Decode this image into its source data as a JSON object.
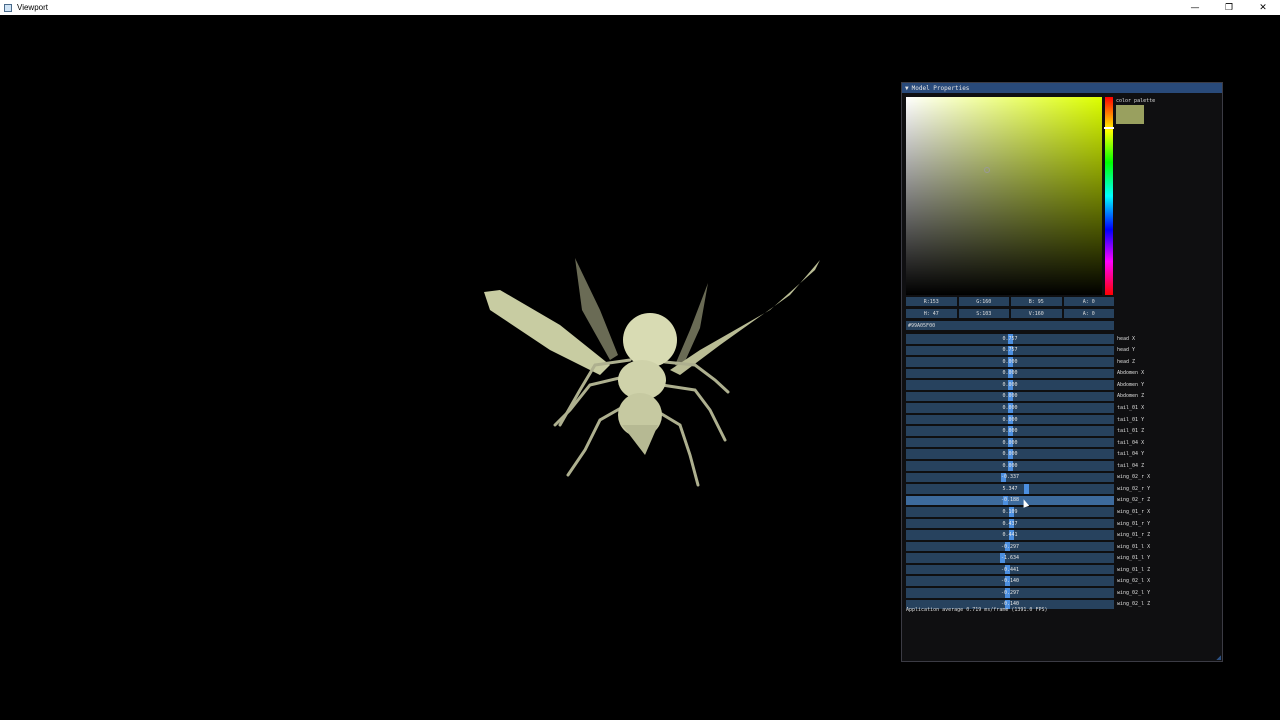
{
  "window": {
    "title": "Viewport",
    "controls": {
      "minimize": "—",
      "maximize": "❐",
      "close": "✕"
    }
  },
  "panel": {
    "title": "Model Properties",
    "collapse_icon": "triangle-down-icon",
    "color_picker": {
      "palette_label": "color palette",
      "swatch_color": "#99A05F",
      "rgba": {
        "r": "R:153",
        "g": "G:160",
        "b": "B: 95",
        "a": "A:  0"
      },
      "hsva": {
        "h": "H: 47",
        "s": "S:103",
        "v": "V:160",
        "a": "A:  0"
      },
      "hex": "#99A05F00"
    },
    "sliders": [
      {
        "value": "0.757",
        "label": "head X",
        "fraction": 0.5
      },
      {
        "value": "0.757",
        "label": "head Y",
        "fraction": 0.5
      },
      {
        "value": "0.000",
        "label": "head Z",
        "fraction": 0.5
      },
      {
        "value": "0.000",
        "label": "Abdomen X",
        "fraction": 0.5
      },
      {
        "value": "0.000",
        "label": "Abdomen Y",
        "fraction": 0.5
      },
      {
        "value": "0.000",
        "label": "Abdomen Z",
        "fraction": 0.5
      },
      {
        "value": "0.000",
        "label": "tail_01 X",
        "fraction": 0.5
      },
      {
        "value": "0.000",
        "label": "tail_01 Y",
        "fraction": 0.5
      },
      {
        "value": "0.000",
        "label": "tail_01 Z",
        "fraction": 0.5
      },
      {
        "value": "0.000",
        "label": "tail_04 X",
        "fraction": 0.5
      },
      {
        "value": "0.000",
        "label": "tail_04 Y",
        "fraction": 0.5
      },
      {
        "value": "0.000",
        "label": "tail_04 Z",
        "fraction": 0.5
      },
      {
        "value": "-0.337",
        "label": "wing_02_r X",
        "fraction": 0.47
      },
      {
        "value": "5.347",
        "label": "wing_02_r Y",
        "fraction": 0.58
      },
      {
        "value": "-0.188",
        "label": "wing_02_r Z",
        "fraction": 0.48,
        "active": true
      },
      {
        "value": "0.109",
        "label": "wing_01_r X",
        "fraction": 0.505
      },
      {
        "value": "0.437",
        "label": "wing_01_r Y",
        "fraction": 0.505
      },
      {
        "value": "0.441",
        "label": "wing_01_r Z",
        "fraction": 0.505
      },
      {
        "value": "-0.297",
        "label": "wing_01_l X",
        "fraction": 0.49
      },
      {
        "value": "-1.634",
        "label": "wing_01_l Y",
        "fraction": 0.465
      },
      {
        "value": "-0.441",
        "label": "wing_01_l Z",
        "fraction": 0.49
      },
      {
        "value": "-0.140",
        "label": "wing_02_l X",
        "fraction": 0.49
      },
      {
        "value": "-0.297",
        "label": "wing_02_l Y",
        "fraction": 0.49
      },
      {
        "value": "-0.140",
        "label": "wing_02_l Z",
        "fraction": 0.49
      }
    ],
    "fps_text": "Application average 0.719 ms/frame (1391.0 FPS)"
  }
}
